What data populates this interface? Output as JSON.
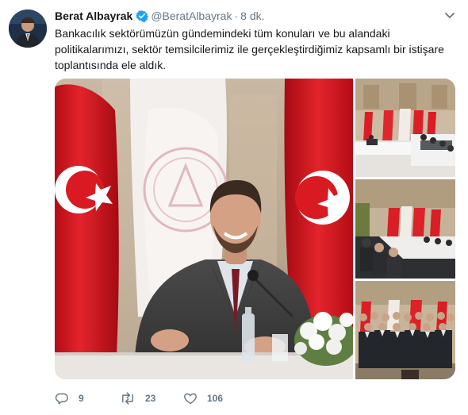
{
  "tweet": {
    "author_name": "Berat Albayrak",
    "handle": "@BeratAlbayrak",
    "separator": "·",
    "time": "8 dk.",
    "text": "Bankacılık sektörümüzün gündemindeki tüm konuları ve bu alandaki politikalarımızı, sektör temsilcilerimiz ile gerçekleştirdiğimiz kapsamlı bir istişare toplantısında ele aldık.",
    "reply_count": "9",
    "retweet_count": "23",
    "like_count": "106"
  },
  "icons": {
    "verified": "verified-badge-icon",
    "caret": "chevron-down-icon",
    "reply": "speech-bubble-icon",
    "retweet": "retweet-arrows-icon",
    "like": "heart-icon"
  },
  "colors": {
    "text": "#14171a",
    "secondary": "#657786",
    "verified": "#1da1f2",
    "flag_red": "#e30a17"
  }
}
